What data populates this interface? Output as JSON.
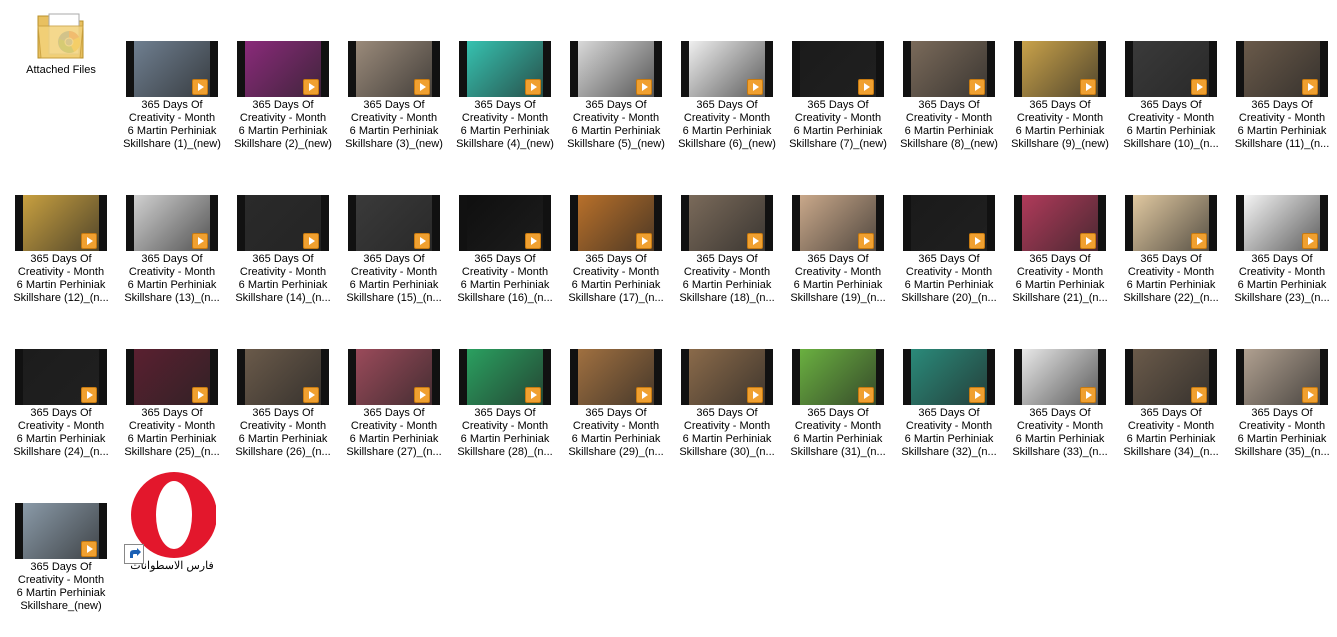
{
  "desktop": {
    "folder": {
      "label": "Attached Files",
      "icon": "folder-icon"
    },
    "shortcut": {
      "label": "فارس الاسطوانات",
      "icon": "opera-icon"
    },
    "videos": [
      {
        "label": "365 Days Of\nCreativity - Month\n6  Martin Perhiniak\nSkillshare (1)_(new)",
        "bg": "#6f7f90"
      },
      {
        "label": "365 Days Of\nCreativity - Month\n6  Martin Perhiniak\nSkillshare (2)_(new)",
        "bg": "#8a2a7a"
      },
      {
        "label": "365 Days Of\nCreativity - Month\n6  Martin Perhiniak\nSkillshare (3)_(new)",
        "bg": "#9a8a7a"
      },
      {
        "label": "365 Days Of\nCreativity - Month\n6  Martin Perhiniak\nSkillshare (4)_(new)",
        "bg": "#36c2b0"
      },
      {
        "label": "365 Days Of\nCreativity - Month\n6  Martin Perhiniak\nSkillshare (5)_(new)",
        "bg": "#d9d9d9"
      },
      {
        "label": "365 Days Of\nCreativity - Month\n6  Martin Perhiniak\nSkillshare (6)_(new)",
        "bg": "#efefef"
      },
      {
        "label": "365 Days Of\nCreativity - Month\n6  Martin Perhiniak\nSkillshare (7)_(new)",
        "bg": "#1b1b1b"
      },
      {
        "label": "365 Days Of\nCreativity - Month\n6  Martin Perhiniak\nSkillshare (8)_(new)",
        "bg": "#7a6a5a"
      },
      {
        "label": "365 Days Of\nCreativity - Month\n6  Martin Perhiniak\nSkillshare (9)_(new)",
        "bg": "#c9a24a"
      },
      {
        "label": "365 Days Of\nCreativity - Month\n6  Martin Perhiniak\nSkillshare (10)_(n...",
        "bg": "#3a3a3a"
      },
      {
        "label": "365 Days Of\nCreativity - Month\n6  Martin Perhiniak\nSkillshare (11)_(n...",
        "bg": "#6a5a4a"
      },
      {
        "label": "365 Days Of\nCreativity - Month\n6  Martin Perhiniak\nSkillshare (12)_(n...",
        "bg": "#c8a040"
      },
      {
        "label": "365 Days Of\nCreativity - Month\n6  Martin Perhiniak\nSkillshare (13)_(n...",
        "bg": "#d0d0d0"
      },
      {
        "label": "365 Days Of\nCreativity - Month\n6  Martin Perhiniak\nSkillshare (14)_(n...",
        "bg": "#2a2a2a"
      },
      {
        "label": "365 Days Of\nCreativity - Month\n6  Martin Perhiniak\nSkillshare (15)_(n...",
        "bg": "#3a3a3a"
      },
      {
        "label": "365 Days Of\nCreativity - Month\n6  Martin Perhiniak\nSkillshare (16)_(n...",
        "bg": "#0f0f0f"
      },
      {
        "label": "365 Days Of\nCreativity - Month\n6  Martin Perhiniak\nSkillshare (17)_(n...",
        "bg": "#b8702a"
      },
      {
        "label": "365 Days Of\nCreativity - Month\n6  Martin Perhiniak\nSkillshare (18)_(n...",
        "bg": "#7a6a5a"
      },
      {
        "label": "365 Days Of\nCreativity - Month\n6  Martin Perhiniak\nSkillshare (19)_(n...",
        "bg": "#c9a88a"
      },
      {
        "label": "365 Days Of\nCreativity - Month\n6  Martin Perhiniak\nSkillshare (20)_(n...",
        "bg": "#1a1a1a"
      },
      {
        "label": "365 Days Of\nCreativity - Month\n6  Martin Perhiniak\nSkillshare (21)_(n...",
        "bg": "#b03a5a"
      },
      {
        "label": "365 Days Of\nCreativity - Month\n6  Martin Perhiniak\nSkillshare (22)_(n...",
        "bg": "#e0c8a0"
      },
      {
        "label": "365 Days Of\nCreativity - Month\n6  Martin Perhiniak\nSkillshare (23)_(n...",
        "bg": "#f4f4f4"
      },
      {
        "label": "365 Days Of\nCreativity - Month\n6  Martin Perhiniak\nSkillshare (24)_(n...",
        "bg": "#1c1c1c"
      },
      {
        "label": "365 Days Of\nCreativity - Month\n6  Martin Perhiniak\nSkillshare (25)_(n...",
        "bg": "#5a2030"
      },
      {
        "label": "365 Days Of\nCreativity - Month\n6  Martin Perhiniak\nSkillshare (26)_(n...",
        "bg": "#6a5a4a"
      },
      {
        "label": "365 Days Of\nCreativity - Month\n6  Martin Perhiniak\nSkillshare (27)_(n...",
        "bg": "#9a4a5a"
      },
      {
        "label": "365 Days Of\nCreativity - Month\n6  Martin Perhiniak\nSkillshare (28)_(n...",
        "bg": "#2aa060"
      },
      {
        "label": "365 Days Of\nCreativity - Month\n6  Martin Perhiniak\nSkillshare (29)_(n...",
        "bg": "#a07040"
      },
      {
        "label": "365 Days Of\nCreativity - Month\n6  Martin Perhiniak\nSkillshare (30)_(n...",
        "bg": "#8a6a4a"
      },
      {
        "label": "365 Days Of\nCreativity - Month\n6  Martin Perhiniak\nSkillshare (31)_(n...",
        "bg": "#6ab040"
      },
      {
        "label": "365 Days Of\nCreativity - Month\n6  Martin Perhiniak\nSkillshare (32)_(n...",
        "bg": "#2a8a7a"
      },
      {
        "label": "365 Days Of\nCreativity - Month\n6  Martin Perhiniak\nSkillshare (33)_(n...",
        "bg": "#e8e8e8"
      },
      {
        "label": "365 Days Of\nCreativity - Month\n6  Martin Perhiniak\nSkillshare (34)_(n...",
        "bg": "#6a5a4a"
      },
      {
        "label": "365 Days Of\nCreativity - Month\n6  Martin Perhiniak\nSkillshare (35)_(n...",
        "bg": "#b0a090"
      },
      {
        "label": "365 Days Of\nCreativity - Month\n6  Martin Perhiniak\nSkillshare_(new)",
        "bg": "#8a9aa8"
      }
    ]
  }
}
